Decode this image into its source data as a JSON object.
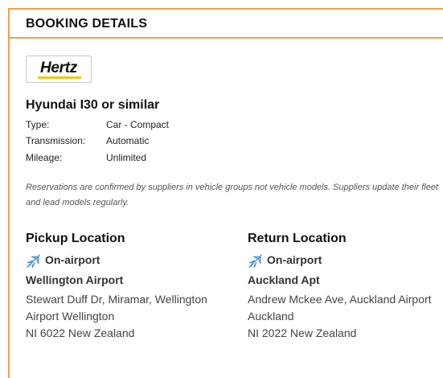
{
  "header": {
    "title": "BOOKING DETAILS"
  },
  "supplier": {
    "logo_text": "Hertz",
    "logo_accent": "#f7c600"
  },
  "vehicle": {
    "name": "Hyundai I30 or similar",
    "specs": [
      {
        "label": "Type:",
        "value": "Car - Compact"
      },
      {
        "label": "Transmission:",
        "value": "Automatic"
      },
      {
        "label": "Mileage:",
        "value": "Unlimited"
      }
    ]
  },
  "disclaimer": "Reservations are confirmed by suppliers in vehicle groups not vehicle models. Suppliers update their fleet and lead models regularly.",
  "pickup": {
    "title": "Pickup Location",
    "type_icon": "airplane-icon",
    "type_label": "On-airport",
    "name": "Wellington Airport",
    "address_lines": [
      "Stewart Duff Dr, Miramar, Wellington",
      "Airport Wellington",
      "NI 6022 New Zealand"
    ]
  },
  "return": {
    "title": "Return Location",
    "type_icon": "airplane-icon",
    "type_label": "On-airport",
    "name": "Auckland Apt",
    "address_lines": [
      "Andrew Mckee Ave, Auckland Airport",
      "Auckland",
      "NI 2022 New Zealand"
    ]
  },
  "colors": {
    "accent_border": "#f0a24a",
    "icon_blue": "#3d8fd6"
  }
}
